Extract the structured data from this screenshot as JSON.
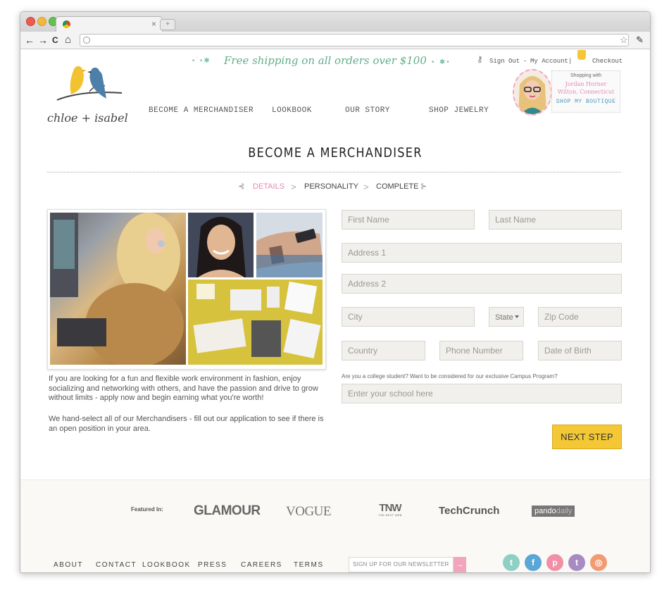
{
  "browser": {
    "tab_close": "×",
    "nav": {
      "back": "←",
      "forward": "→",
      "reload": "C",
      "home": "⌂"
    },
    "star": "☆",
    "wrench": "✎"
  },
  "banner": {
    "text": "Free shipping on all orders over $100"
  },
  "brand": {
    "logo_text": "chloe + isabel"
  },
  "account": {
    "sign_out": "Sign Out",
    "my_account": "My Account",
    "separator": "|",
    "dash": "-",
    "checkout": "Checkout"
  },
  "shopping": {
    "label": "Shopping with",
    "name": "Jordan Horner",
    "location": "Wilton, Connecticut",
    "cta": "SHOP MY BOUTIQUE"
  },
  "main_nav": [
    {
      "label": "BECOME A MERCHANDISER"
    },
    {
      "label": "LOOKBOOK"
    },
    {
      "label": "OUR STORY"
    },
    {
      "label": "SHOP JEWELRY"
    }
  ],
  "page_title": "BECOME A MERCHANDISER",
  "steps": {
    "details": "DETAILS",
    "personality": "PERSONALITY",
    "complete": "COMPLETE",
    "sep": ">"
  },
  "intro": {
    "para1": "If you are looking for a fun and flexible work environment in fashion, enjoy socializing and networking with others, and have the passion and drive to grow without limits - apply now and begin earning what you're worth!",
    "para2": "We hand-select all of our Merchandisers - fill out our application to see if there is an open position in your area."
  },
  "form": {
    "first_name": "First Name",
    "last_name": "Last Name",
    "address1": "Address 1",
    "address2": "Address 2",
    "city": "City",
    "state": "State",
    "zip": "Zip Code",
    "country": "Country",
    "phone": "Phone Number",
    "dob": "Date of Birth",
    "college_question": "Are you a college student? Want to be considered for our exclusive Campus Program?",
    "school_placeholder": "Enter your school here",
    "next_button": "NEXT STEP"
  },
  "featured": {
    "label": "Featured In:",
    "logos": [
      {
        "name": "GLAMOUR"
      },
      {
        "name": "VOGUE"
      },
      {
        "name": "TNW",
        "sub": "THE NEXT WEB"
      },
      {
        "name": "TechCrunch"
      },
      {
        "name": "pando",
        "suffix": "daily"
      }
    ]
  },
  "footer": {
    "links": [
      {
        "label": "ABOUT"
      },
      {
        "label": "CONTACT"
      },
      {
        "label": "LOOKBOOK"
      },
      {
        "label": "PRESS"
      },
      {
        "label": "CAREERS"
      },
      {
        "label": "TERMS"
      }
    ],
    "newsletter_placeholder": "SIGN UP FOR OUR NEWSLETTER",
    "newsletter_arrow": "→",
    "social": [
      {
        "name": "twitter",
        "glyph": "t",
        "color": "#8fd0c4"
      },
      {
        "name": "facebook",
        "glyph": "f",
        "color": "#5aa6d6"
      },
      {
        "name": "pinterest",
        "glyph": "p",
        "color": "#f08fa6"
      },
      {
        "name": "tumblr",
        "glyph": "t",
        "color": "#a98bc4"
      },
      {
        "name": "instagram",
        "glyph": "◎",
        "color": "#f29b73"
      }
    ]
  },
  "colors": {
    "accent_pink": "#e48ab3",
    "accent_yellow": "#f3c834",
    "script_green": "#5fae8a"
  }
}
